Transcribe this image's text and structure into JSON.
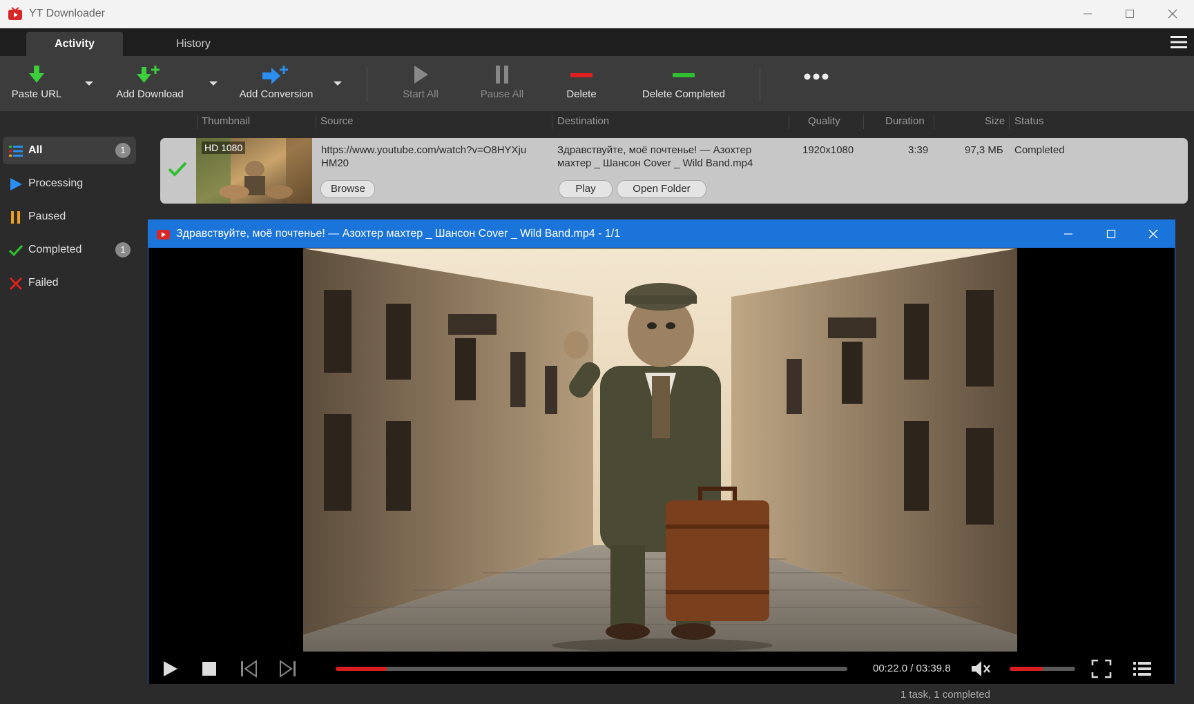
{
  "app": {
    "title": "YT Downloader",
    "accent": "#1b74d9",
    "danger": "#e02020",
    "success": "#2fbf2f"
  },
  "tabs": [
    {
      "label": "Activity",
      "active": true
    },
    {
      "label": "History",
      "active": false
    }
  ],
  "toolbar": {
    "paste_url": "Paste URL",
    "add_download": "Add Download",
    "add_conversion": "Add Conversion",
    "start_all": "Start All",
    "pause_all": "Pause All",
    "delete": "Delete",
    "delete_completed": "Delete Completed",
    "more": "•••"
  },
  "columns": {
    "thumbnail": "Thumbnail",
    "source": "Source",
    "destination": "Destination",
    "quality": "Quality",
    "duration": "Duration",
    "size": "Size",
    "status": "Status"
  },
  "sidebar": {
    "items": [
      {
        "label": "All",
        "badge": "1",
        "icon": "list-icon"
      },
      {
        "label": "Processing",
        "badge": "",
        "icon": "play-icon"
      },
      {
        "label": "Paused",
        "badge": "",
        "icon": "pause-icon"
      },
      {
        "label": "Completed",
        "badge": "1",
        "icon": "check-icon"
      },
      {
        "label": "Failed",
        "badge": "",
        "icon": "cross-icon"
      }
    ]
  },
  "downloads": [
    {
      "thumbnail_badge": "HD 1080",
      "source_line1": "https://www.youtube.com/watch?v=O8HYXju",
      "source_line2": "HM20",
      "destination_line1": "Здравствуйте, моё почтенье! — Азохтер",
      "destination_line2": "махтер _ Шансон Cover _ Wild Band.mp4",
      "quality": "1920x1080",
      "duration": "3:39",
      "size": "97,3 МБ",
      "status": "Completed",
      "browse": "Browse",
      "play": "Play",
      "open_folder": "Open Folder"
    }
  ],
  "player": {
    "title": "Здравствуйте, моё почтенье! — Азохтер махтер _ Шансон Cover _ Wild Band.mp4 - 1/1",
    "timecode": "00:22.0 / 03:39.8",
    "progress": 0.1,
    "volume": 0.5,
    "muted": true
  },
  "status_bar": {
    "text": "1 task, 1 completed"
  }
}
